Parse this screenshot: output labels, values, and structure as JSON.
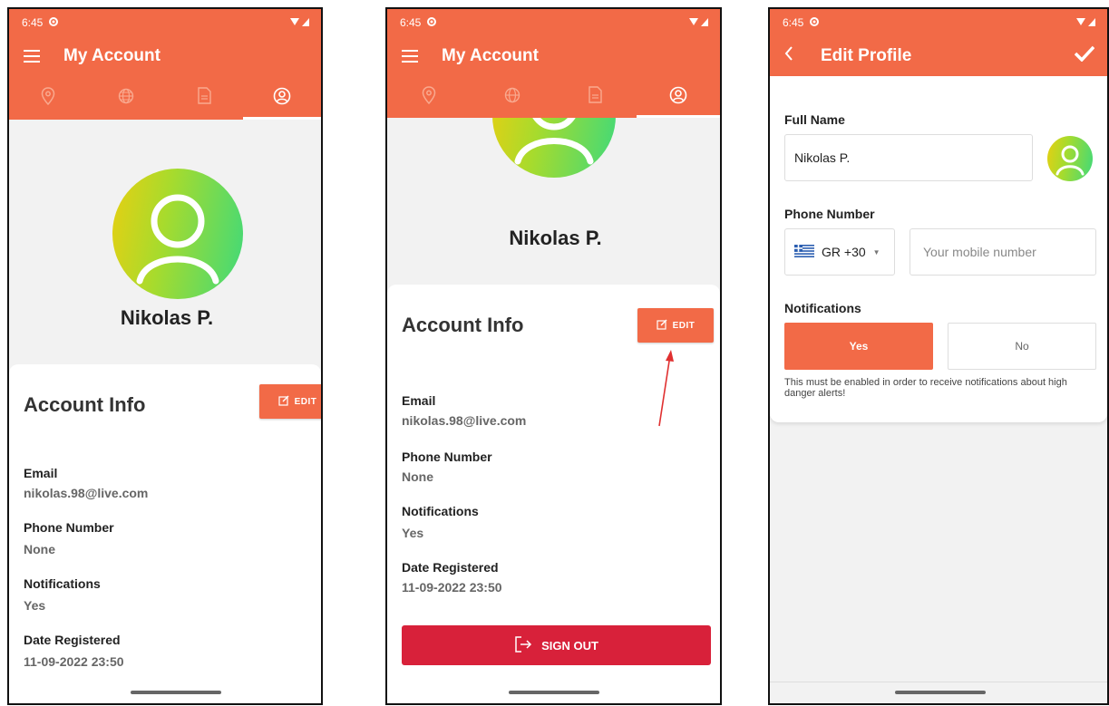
{
  "status": {
    "time": "6:45"
  },
  "colors": {
    "primary": "#f26a47",
    "danger": "#d8213a",
    "avatar_gradient": [
      "#e8cf11",
      "#3fd97a"
    ]
  },
  "screen1": {
    "title": "My Account",
    "tabs": [
      "location-pin-icon",
      "globe-icon",
      "document-icon",
      "profile-icon"
    ],
    "name": "Nikolas P.",
    "card_title": "Account Info",
    "edit_label": "EDIT",
    "fields": [
      {
        "label": "Email",
        "value": "nikolas.98@live.com"
      },
      {
        "label": "Phone Number",
        "value": "None"
      },
      {
        "label": "Notifications",
        "value": "Yes"
      },
      {
        "label": "Date Registered",
        "value": "11-09-2022 23:50"
      }
    ]
  },
  "screen2": {
    "title": "My Account",
    "name": "Nikolas P.",
    "card_title": "Account Info",
    "edit_label": "EDIT",
    "fields": [
      {
        "label": "Email",
        "value": "nikolas.98@live.com"
      },
      {
        "label": "Phone Number",
        "value": "None"
      },
      {
        "label": "Notifications",
        "value": "Yes"
      },
      {
        "label": "Date Registered",
        "value": "11-09-2022 23:50"
      }
    ],
    "signout_label": "SIGN OUT"
  },
  "screen3": {
    "title": "Edit Profile",
    "full_name_label": "Full Name",
    "full_name_value": "Nikolas P.",
    "phone_label": "Phone Number",
    "country_code": "GR +30",
    "phone_placeholder": "Your mobile number",
    "notifications_label": "Notifications",
    "yes_label": "Yes",
    "no_label": "No",
    "hint": "This must be enabled in order to receive notifications about high danger alerts!"
  }
}
